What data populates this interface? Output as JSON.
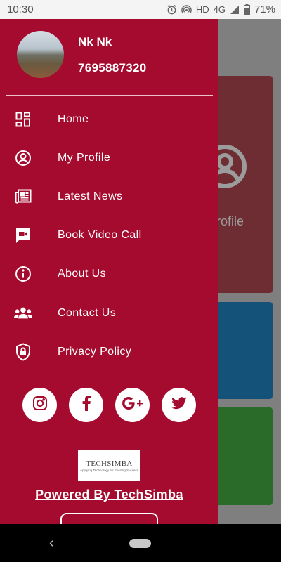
{
  "status_bar": {
    "time": "10:30",
    "network_hd": "HD",
    "network_type": "4G",
    "battery": "71%"
  },
  "drawer": {
    "user_name": "Nk Nk",
    "user_phone": "7695887320",
    "menu_items": [
      {
        "label": "Home",
        "icon": "grid-dashboard-icon"
      },
      {
        "label": "My Profile",
        "icon": "user-circle-icon"
      },
      {
        "label": "Latest News",
        "icon": "newspaper-icon"
      },
      {
        "label": "Book Video Call",
        "icon": "video-call-icon"
      },
      {
        "label": "About Us",
        "icon": "info-icon"
      },
      {
        "label": "Contact Us",
        "icon": "people-icon"
      },
      {
        "label": "Privacy Policy",
        "icon": "shield-lock-icon"
      }
    ],
    "social": [
      "instagram-icon",
      "facebook-icon",
      "google-plus-icon",
      "twitter-icon"
    ],
    "logo_text": "TECHSIMBA",
    "logo_tagline": "Applying Technology for Exciting Success",
    "powered_by": "Powered By TechSimba"
  },
  "background": {
    "profile_card_label": "Profile"
  },
  "colors": {
    "drawer_bg": "#a50b2e",
    "status_bar_bg": "#f4f4f4",
    "overlay": "#7f7f7f"
  }
}
